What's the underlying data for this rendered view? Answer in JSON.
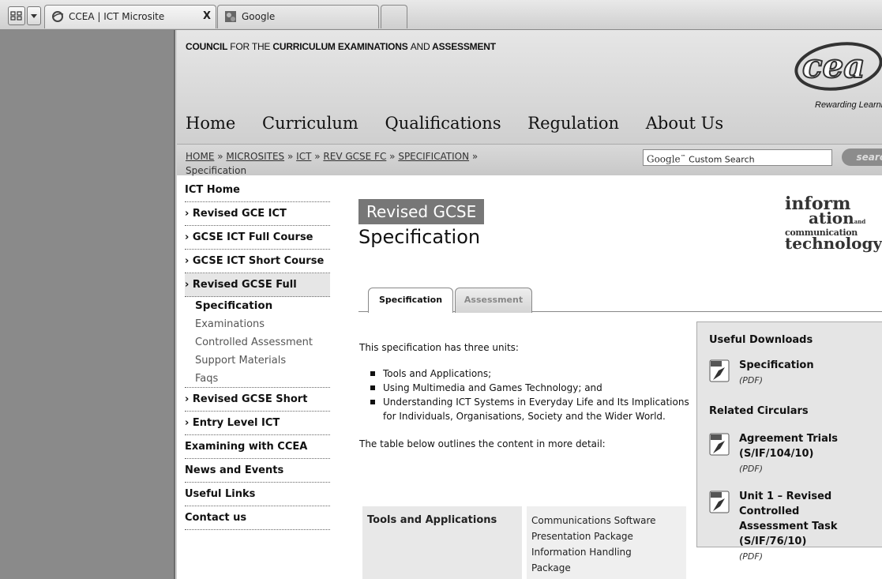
{
  "browser": {
    "tabs": [
      {
        "label": "CCEA | ICT Microsite",
        "close": "X"
      },
      {
        "label": "Google"
      }
    ]
  },
  "header": {
    "council_bold1": "COUNCIL",
    "council_light": "FOR THE",
    "council_bold2": "CURRICULUM EXAMINATIONS",
    "council_light2": "AND",
    "council_bold3": "ASSESSMENT",
    "logo_text": "cea",
    "logo_tagline": "Rewarding Learning",
    "nav": [
      "Home",
      "Curriculum",
      "Qualifications",
      "Regulation",
      "About Us"
    ]
  },
  "breadcrumb": {
    "links": [
      "HOME",
      "MICROSITES",
      "ICT",
      "REV GCSE FC",
      "SPECIFICATION"
    ],
    "sep": "»",
    "current": "Specification"
  },
  "search": {
    "brand": "Google",
    "tm": "™",
    "placeholder": "Custom Search",
    "button": "search"
  },
  "sidebar": {
    "items": [
      {
        "label": "ICT Home"
      },
      {
        "label": "› Revised GCE ICT"
      },
      {
        "label": "› GCSE ICT Full Course"
      },
      {
        "label": "› GCSE ICT Short Course"
      },
      {
        "label": "› Revised GCSE Full"
      }
    ],
    "subitems": [
      "Specification",
      "Examinations",
      "Controlled Assessment",
      "Support Materials",
      "Faqs"
    ],
    "items2": [
      {
        "label": "› Revised GCSE Short"
      },
      {
        "label": "› Entry Level ICT"
      },
      {
        "label": "Examining with CCEA"
      },
      {
        "label": "News and Events"
      },
      {
        "label": "Useful Links"
      },
      {
        "label": "Contact us"
      }
    ]
  },
  "main": {
    "banner": "Revised GCSE",
    "ict_logo": [
      "inform",
      "ation",
      "and",
      "communication",
      "technology"
    ],
    "title": "Specification",
    "tabs": [
      "Specification",
      "Assessment"
    ],
    "intro": "This specification has three units:",
    "units": [
      "Tools and Applications;",
      "Using Multimedia and Games Technology; and",
      "Understanding ICT Systems in Everyday Life and Its Implications for Individuals, Organisations, Society and the Wider World."
    ],
    "table_intro": "The table below outlines the content in more detail:",
    "table": {
      "row1_head": "Tools and Applications",
      "row1_items": [
        "Communications Software",
        "Presentation Package",
        "Information Handling Package"
      ]
    }
  },
  "downloads": {
    "heading": "Useful Downloads",
    "items": [
      {
        "name": "Specification",
        "type": "(PDF)"
      }
    ],
    "circulars_heading": "Related Circulars",
    "circulars": [
      {
        "name": "Agreement Trials (S/IF/104/10)",
        "type": "(PDF)"
      },
      {
        "name": "Unit 1 – Revised Controlled Assessment Task (S/IF/76/10)",
        "type": "(PDF)"
      }
    ]
  }
}
